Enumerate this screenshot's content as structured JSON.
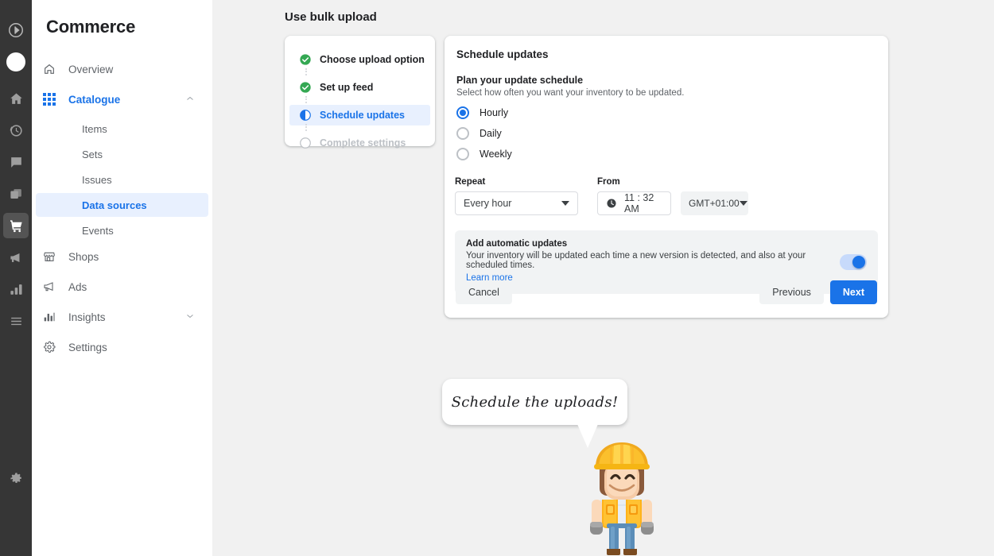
{
  "rail": {
    "items": [
      {
        "name": "workspace-logo-icon",
        "label": "Workspace"
      },
      {
        "name": "account-avatar",
        "label": "Account"
      },
      {
        "name": "home-icon",
        "label": "Home"
      },
      {
        "name": "clock-history-icon",
        "label": "Recent"
      },
      {
        "name": "messages-icon",
        "label": "Messages"
      },
      {
        "name": "pages-icon",
        "label": "Pages"
      },
      {
        "name": "commerce-cart-icon",
        "label": "Commerce"
      },
      {
        "name": "megaphone-icon",
        "label": "Promotions"
      },
      {
        "name": "analytics-bars-icon",
        "label": "Analytics"
      },
      {
        "name": "hamburger-menu-icon",
        "label": "More"
      },
      {
        "name": "gear-icon",
        "label": "Settings"
      }
    ]
  },
  "sidebar": {
    "brand": "Commerce",
    "items": [
      {
        "label": "Overview",
        "icon": "home-outline-icon",
        "selected": false,
        "expandable": false
      },
      {
        "label": "Catalogue",
        "icon": "grid-icon",
        "selected": true,
        "expandable": true,
        "chevron": "chevron-up-icon"
      },
      {
        "label": "Shops",
        "icon": "store-icon",
        "selected": false,
        "expandable": false
      },
      {
        "label": "Ads",
        "icon": "megaphone-outline-icon",
        "selected": false,
        "expandable": false
      },
      {
        "label": "Insights",
        "icon": "bar-chart-icon",
        "selected": false,
        "expandable": true,
        "chevron": "chevron-down-icon"
      },
      {
        "label": "Settings",
        "icon": "gear-outline-icon",
        "selected": false,
        "expandable": false
      }
    ],
    "sub_items": [
      {
        "label": "Items",
        "active": false
      },
      {
        "label": "Sets",
        "active": false
      },
      {
        "label": "Issues",
        "active": false
      },
      {
        "label": "Data sources",
        "active": true
      },
      {
        "label": "Events",
        "active": false
      }
    ]
  },
  "main": {
    "page_title": "Use bulk upload",
    "stepper": {
      "steps": [
        {
          "label": "Choose upload option",
          "state": "complete"
        },
        {
          "label": "Set up feed",
          "state": "complete"
        },
        {
          "label": "Schedule updates",
          "state": "current"
        },
        {
          "label": "Complete settings",
          "state": "pending"
        }
      ]
    },
    "form": {
      "title": "Schedule updates",
      "section_heading": "Plan your update schedule",
      "section_subtext": "Select how often you want your inventory to be updated.",
      "frequency_options": [
        {
          "label": "Hourly",
          "selected": true
        },
        {
          "label": "Daily",
          "selected": false
        },
        {
          "label": "Weekly",
          "selected": false
        }
      ],
      "repeat": {
        "label": "Repeat",
        "value": "Every hour"
      },
      "from": {
        "label": "From",
        "time_value": "11 : 32 AM",
        "timezone_value": "GMT+01:00"
      },
      "auto_updates": {
        "title": "Add automatic updates",
        "description": "Your inventory will be updated each time a new version is detected, and also at your scheduled times.",
        "link": "Learn more",
        "toggle_on": true
      },
      "buttons": {
        "cancel": "Cancel",
        "previous": "Previous",
        "next": "Next"
      }
    },
    "callout": {
      "text": "Schedule the uploads!"
    }
  },
  "colors": {
    "accent_blue": "#1a73e8",
    "accent_blue_light": "#e8f0fe",
    "success_green": "#34a853",
    "page_bg": "#f1f1f1",
    "rail_bg": "#363636",
    "text_primary": "#202124",
    "text_secondary": "#5f6368",
    "helmet_yellow": "#f6c324",
    "vest_orange": "#f5a623",
    "pants_blue": "#5b8db8"
  }
}
